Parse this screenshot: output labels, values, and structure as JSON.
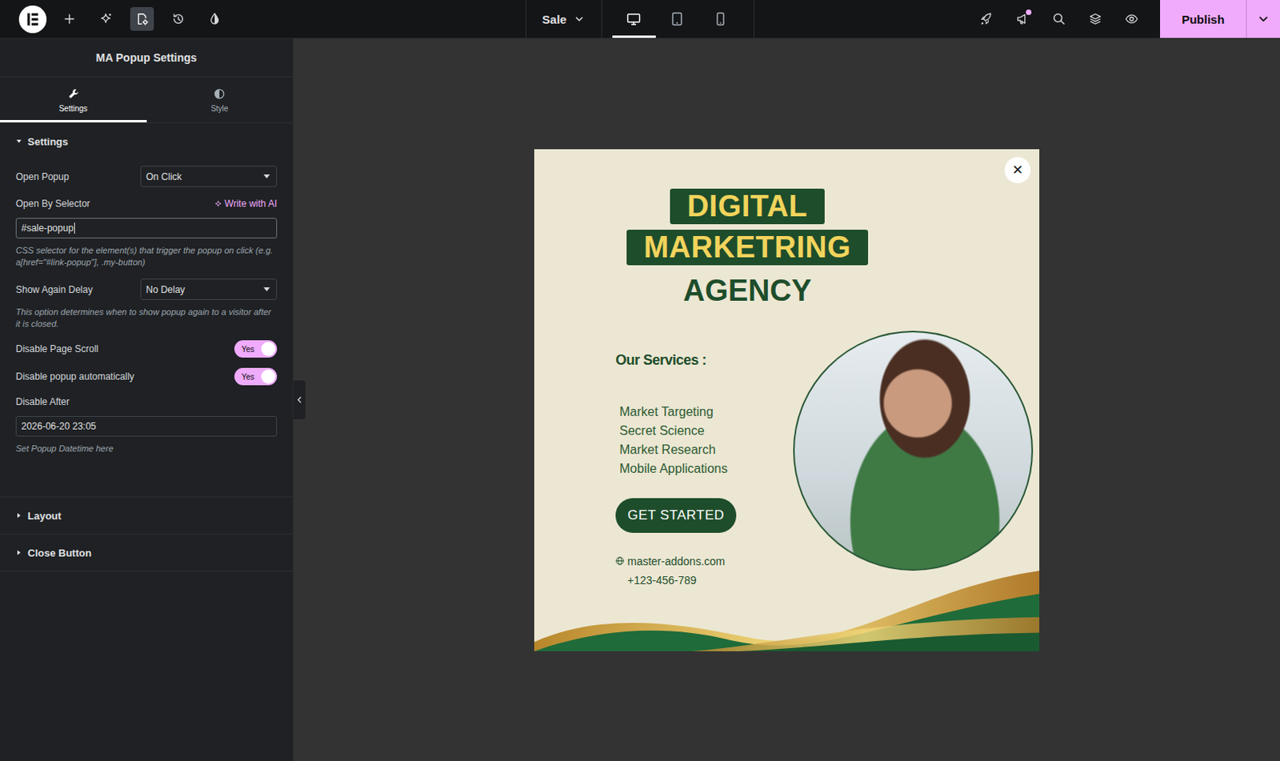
{
  "toolbar": [
    {
      "kind": "add",
      "selected": false
    },
    {
      "kind": "ai",
      "selected": false
    },
    {
      "kind": "page-settings",
      "selected": true
    },
    {
      "kind": "history",
      "selected": false
    },
    {
      "kind": "theme",
      "selected": false
    }
  ],
  "document": {
    "title": "Sale"
  },
  "devices": [
    {
      "kind": "desktop",
      "selected": true
    },
    {
      "kind": "tablet",
      "selected": false
    },
    {
      "kind": "mobile",
      "selected": false
    }
  ],
  "actions": [
    {
      "kind": "launch",
      "badge": false
    },
    {
      "kind": "notifications",
      "badge": true
    },
    {
      "kind": "search",
      "badge": false
    },
    {
      "kind": "structure",
      "badge": false
    },
    {
      "kind": "preview",
      "badge": false
    }
  ],
  "publish": {
    "label": "Publish"
  },
  "panel": {
    "title": "MA Popup Settings",
    "tabs": [
      {
        "kind": "settings",
        "label": "Settings",
        "selected": true
      },
      {
        "kind": "style",
        "label": "Style",
        "selected": false
      }
    ],
    "sections": [
      {
        "label": "Settings",
        "expanded": true,
        "fields": [
          {
            "kind": "select",
            "label": "Open Popup",
            "value": "On Click"
          },
          {
            "kind": "text",
            "label": "Open By Selector",
            "action": "Write with AI",
            "value": "#sale-popup",
            "focused": true,
            "help": "CSS selector for the element(s) that trigger the popup on click (e.g. a[href=\"#link-popup\"], .my-button)"
          },
          {
            "kind": "select",
            "label": "Show Again Delay",
            "value": "No Delay",
            "help": "This option determines when to show popup again to a visitor after it is closed."
          },
          {
            "kind": "toggle",
            "label": "Disable Page Scroll",
            "on": true,
            "value": "Yes"
          },
          {
            "kind": "toggle",
            "label": "Disable popup automatically",
            "on": true,
            "value": "Yes"
          },
          {
            "kind": "text",
            "label": "Disable After",
            "value": "2026-06-20 23:05",
            "focused": false,
            "help": "Set Popup Datetime here"
          }
        ]
      },
      {
        "label": "Layout",
        "expanded": false,
        "fields": []
      },
      {
        "label": "Close Button",
        "expanded": false,
        "fields": []
      }
    ]
  },
  "popup": {
    "close": "✕",
    "heading": [
      {
        "text": "DIGITAL",
        "boxed": true
      },
      {
        "text": "MARKETRING",
        "boxed": true
      },
      {
        "text": "AGENCY",
        "boxed": false
      }
    ],
    "services_title": "Our Services :",
    "services": [
      "Market Targeting",
      "Secret Science",
      "Market Research",
      "Mobile Applications"
    ],
    "button": "GET STARTED",
    "contacts": [
      {
        "kind": "web",
        "text": "master-addons.com"
      },
      {
        "kind": "plain",
        "text": "+123-456-789"
      }
    ]
  }
}
